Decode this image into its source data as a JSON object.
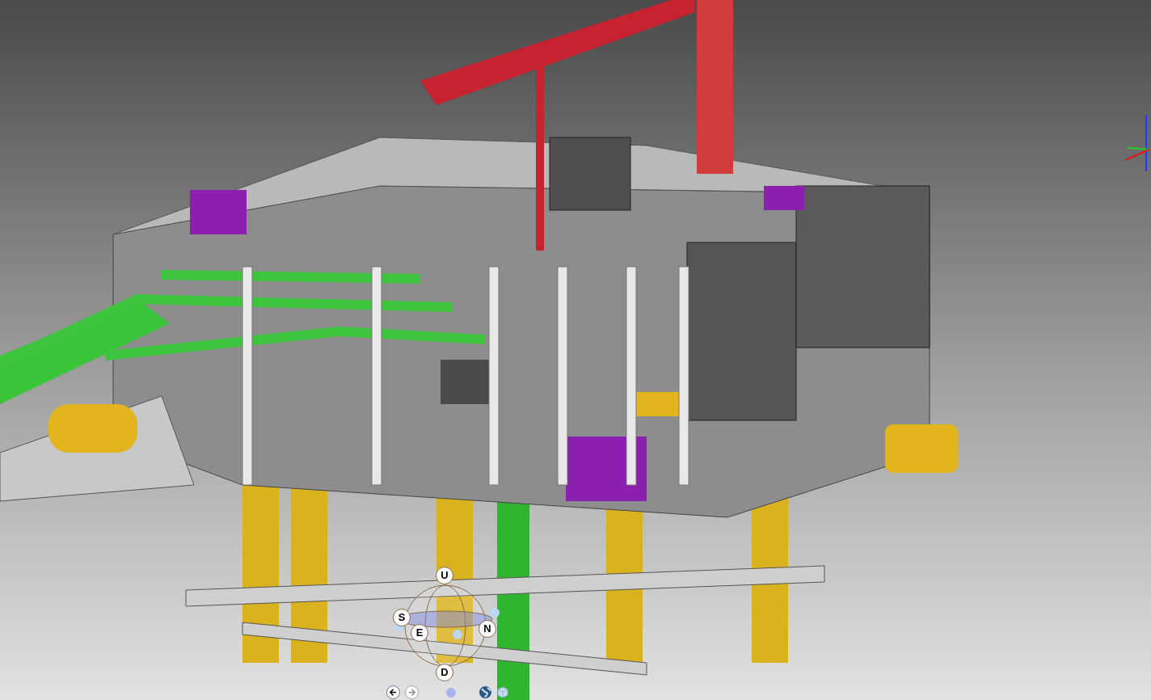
{
  "compass": {
    "up": "U",
    "south": "S",
    "east": "E",
    "north": "N",
    "down": "D"
  }
}
